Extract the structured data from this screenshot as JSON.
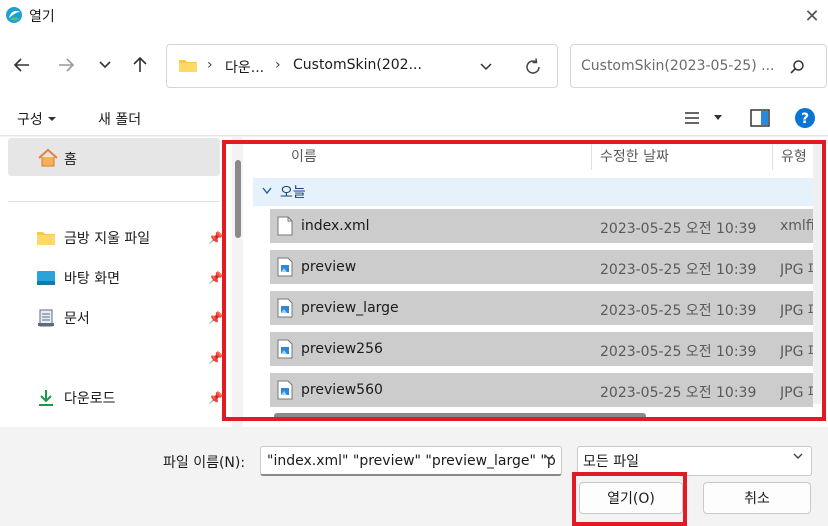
{
  "window": {
    "title": "열기",
    "close_glyph": "✕"
  },
  "nav": {
    "back_icon": "arrow-left-icon",
    "forward_icon": "arrow-right-icon",
    "recent_icon": "chevron-down-icon",
    "up_icon": "arrow-up-icon",
    "breadcrumb": [
      "다운...",
      "CustomSkin(202..."
    ],
    "refresh_icon": "refresh-icon",
    "search_placeholder": "CustomSkin(2023-05-25) ...",
    "search_icon": "search-icon"
  },
  "toolbar": {
    "organize_label": "구성",
    "new_folder_label": "새 폴더"
  },
  "sidebar": {
    "home_label": "홈",
    "items": [
      {
        "label": "금방 지울 파일",
        "icon": "folder-icon"
      },
      {
        "label": "바탕 화면",
        "icon": "desktop-icon"
      },
      {
        "label": "문서",
        "icon": "document-icon"
      },
      {
        "label": "",
        "icon": "blank"
      },
      {
        "label": "다운로드",
        "icon": "download-icon"
      }
    ]
  },
  "list": {
    "columns": [
      "이름",
      "수정한 날짜",
      "유형"
    ],
    "group_label": "오늘",
    "rows": [
      {
        "name": "index.xml",
        "date": "2023-05-25 오전 10:39",
        "type": "xmlfi",
        "icon": "file-icon"
      },
      {
        "name": "preview",
        "date": "2023-05-25 오전 10:39",
        "type": "JPG 파",
        "icon": "image-file-icon"
      },
      {
        "name": "preview_large",
        "date": "2023-05-25 오전 10:39",
        "type": "JPG 파",
        "icon": "image-file-icon"
      },
      {
        "name": "preview256",
        "date": "2023-05-25 오전 10:39",
        "type": "JPG 파",
        "icon": "image-file-icon"
      },
      {
        "name": "preview560",
        "date": "2023-05-25 오전 10:39",
        "type": "JPG 파",
        "icon": "image-file-icon"
      }
    ]
  },
  "footer": {
    "filename_label": "파일 이름(N):",
    "filename_value": "\"index.xml\" \"preview\" \"preview_large\" \"p",
    "filetype_value": "모든 파일",
    "open_label": "열기(O)",
    "cancel_label": "취소"
  },
  "colors": {
    "highlight_red": "#e01b24",
    "selected_row": "#cccccc",
    "accent_blue": "#0067c0"
  }
}
